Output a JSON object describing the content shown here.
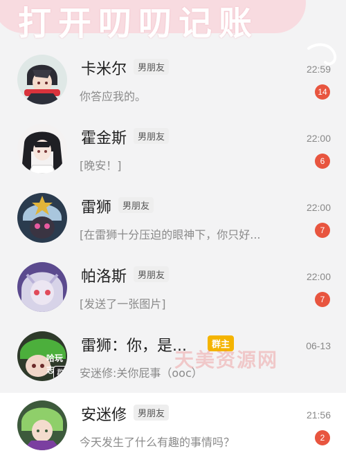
{
  "banner": {
    "title": "打开叨叨记账"
  },
  "conversations": [
    {
      "name": "卡米尔",
      "tag": "男朋友",
      "time": "22:59",
      "preview": "你答应我的。",
      "unread": "14"
    },
    {
      "name": "霍金斯",
      "tag": "男朋友",
      "time": "22:00",
      "preview": "[晚安！]",
      "unread": "6"
    },
    {
      "name": "雷狮",
      "tag": "男朋友",
      "time": "22:00",
      "preview": "[在雷狮十分压迫的眼神下，你只好...",
      "unread": "7"
    },
    {
      "name": "帕洛斯",
      "tag": "男朋友",
      "time": "22:00",
      "preview": "[发送了一张图片]",
      "unread": "7"
    },
    {
      "name": "雷狮：你，是...",
      "tag": "群主",
      "time": "06-13",
      "preview": "安迷修:关你屁事（ooc）",
      "avatar_label": "哈玩志",
      "group_mark": "群"
    },
    {
      "name": "安迷修",
      "tag": "男朋友",
      "time": "21:56",
      "preview": "今天发生了什么有趣的事情吗？",
      "unread": "2"
    }
  ],
  "watermark": "天美资源网",
  "colors": {
    "badge": "#e8553f",
    "banner": "#f8dbe0",
    "owner_tag": "#f4b400"
  },
  "icons": {
    "group_mark": "group-chat-icon",
    "corner": "swirl-decoration-icon"
  }
}
